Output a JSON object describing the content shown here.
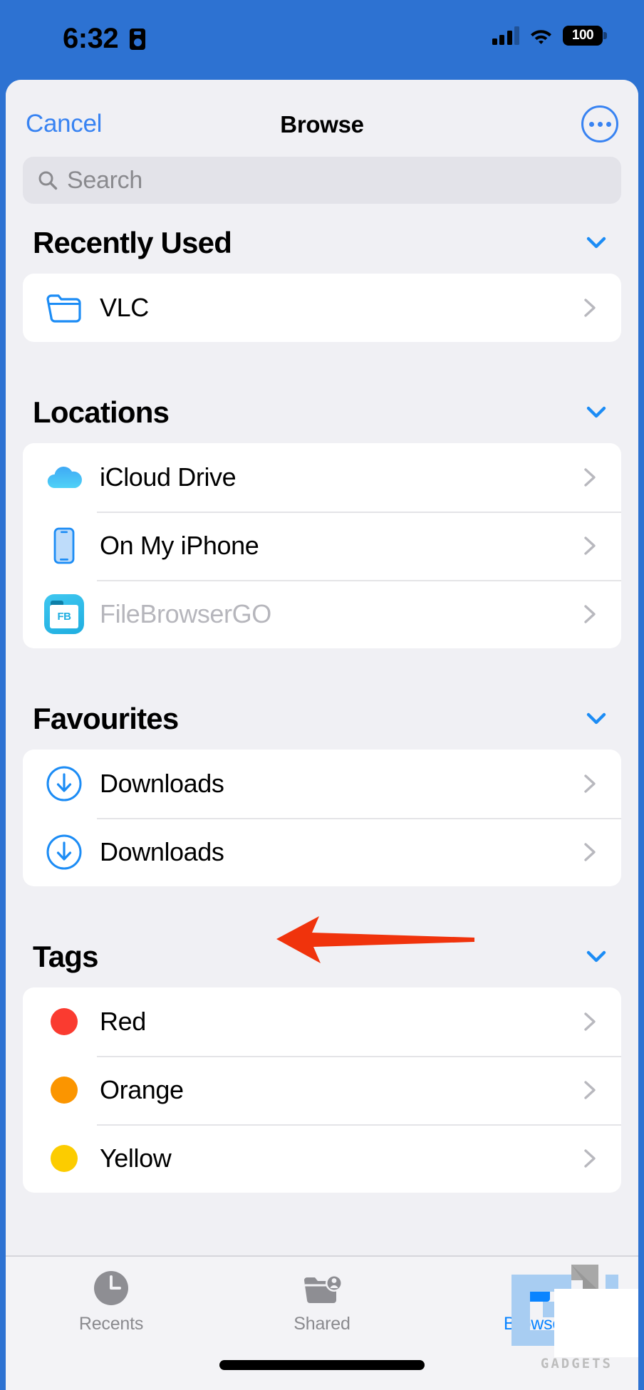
{
  "status_bar": {
    "time": "6:32",
    "battery_level": "100",
    "signal_icon": "cellular-signal-icon",
    "wifi_icon": "wifi-icon",
    "battery_icon": "battery-icon",
    "dynamic_island_icon": "face-id-icon"
  },
  "navbar": {
    "cancel_label": "Cancel",
    "title": "Browse",
    "more_icon": "more-ellipsis-icon"
  },
  "search": {
    "placeholder": "Search",
    "value": "",
    "icon": "search-icon"
  },
  "sections": [
    {
      "title": "Recently Used",
      "collapse_icon": "chevron-down-icon",
      "rows": [
        {
          "label": "VLC",
          "icon": "folder-outline-icon",
          "disclosure": "chevron-right-icon",
          "disabled": false
        }
      ]
    },
    {
      "title": "Locations",
      "collapse_icon": "chevron-down-icon",
      "rows": [
        {
          "label": "iCloud Drive",
          "icon": "icloud-drive-icon",
          "disclosure": "chevron-right-icon",
          "disabled": false
        },
        {
          "label": "On My iPhone",
          "icon": "iphone-icon",
          "disclosure": "chevron-right-icon",
          "disabled": false
        },
        {
          "label": "FileBrowserGO",
          "icon": "filebrowsergo-app-icon",
          "icon_text": "FB",
          "disclosure": "chevron-right-icon",
          "disabled": true
        }
      ]
    },
    {
      "title": "Favourites",
      "collapse_icon": "chevron-down-icon",
      "rows": [
        {
          "label": "Downloads",
          "icon": "download-circle-icon",
          "disclosure": "chevron-right-icon",
          "disabled": false
        },
        {
          "label": "Downloads",
          "icon": "download-circle-icon",
          "disclosure": "chevron-right-icon",
          "disabled": false
        }
      ]
    },
    {
      "title": "Tags",
      "collapse_icon": "chevron-down-icon",
      "rows": [
        {
          "label": "Red",
          "icon": "tag-dot-icon",
          "color": "#FA3B30",
          "disclosure": "chevron-right-icon",
          "disabled": false
        },
        {
          "label": "Orange",
          "icon": "tag-dot-icon",
          "color": "#FB9500",
          "disclosure": "chevron-right-icon",
          "disabled": false
        },
        {
          "label": "Yellow",
          "icon": "tag-dot-icon",
          "color": "#FCCC00",
          "disclosure": "chevron-right-icon",
          "disabled": false
        }
      ]
    }
  ],
  "tabbar": {
    "tabs": [
      {
        "label": "Recents",
        "icon": "clock-icon",
        "active": false
      },
      {
        "label": "Shared",
        "icon": "shared-folder-person-icon",
        "active": false
      },
      {
        "label": "Browse",
        "icon": "folder-filled-icon",
        "active": true
      }
    ]
  },
  "annotation": {
    "arrow_icon": "red-left-arrow-icon",
    "color": "#F0330C",
    "points_at": "Downloads"
  },
  "watermark": {
    "logo_icon": "gt-gadgets-logo-icon",
    "text": "GADGETS"
  },
  "colors": {
    "accent_blue": "#0A84FF",
    "link_blue": "#3883F2",
    "status_bar_bg": "#2D72D2",
    "sheet_bg": "#F0F0F4",
    "card_bg": "#FFFFFF",
    "annotation_red": "#F0330C"
  }
}
